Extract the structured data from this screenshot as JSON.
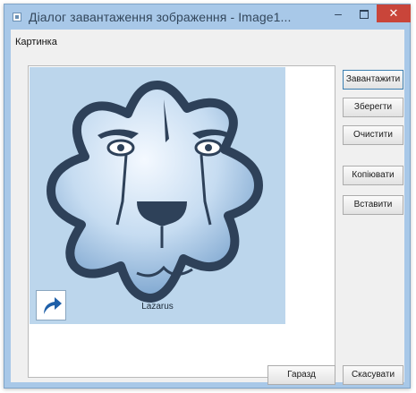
{
  "window": {
    "title": "Діалог завантаження зображення - Image1...",
    "minimize_label": "–",
    "close_label": "✕"
  },
  "group": {
    "label": "Картинка"
  },
  "picture": {
    "caption": "Lazarus"
  },
  "buttons": {
    "load": "Завантажити",
    "save": "Зберегти",
    "clear": "Очистити",
    "copy": "Копіювати",
    "paste": "Вставити",
    "ok": "Гаразд",
    "cancel": "Скасувати"
  },
  "colors": {
    "titlebar": "#a8c8e8",
    "close_button": "#c9453a",
    "picture_background": "#bcd6ec",
    "gear_outline": "#2e4159"
  },
  "icons": {
    "window": "app-window-icon",
    "shortcut": "shortcut-arrow-icon",
    "logo": "lazarus-lion-gear-logo"
  }
}
